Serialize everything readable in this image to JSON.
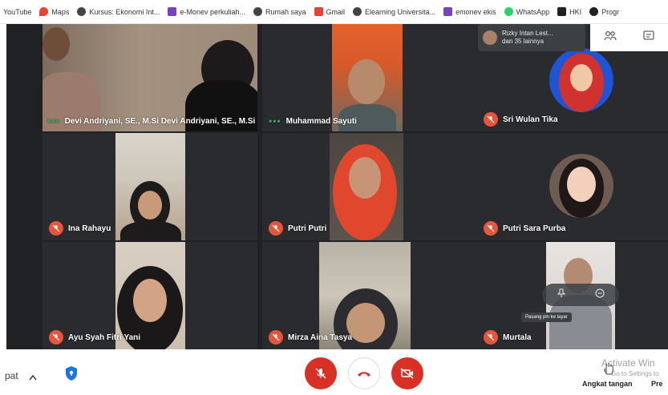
{
  "bookmarks": [
    {
      "label": "YouTube",
      "color": "#ffffff"
    },
    {
      "label": "Maps",
      "color": "#ea4335"
    },
    {
      "label": "Kursus: Ekonomi Int...",
      "color": "#444444"
    },
    {
      "label": "e-Monev perkuliah...",
      "color": "#7b3fbf"
    },
    {
      "label": "Rumah saya",
      "color": "#444444"
    },
    {
      "label": "Gmail",
      "color": "#ea4335"
    },
    {
      "label": "Elearning Universita...",
      "color": "#444444"
    },
    {
      "label": "emonev ekis",
      "color": "#7b3fbf"
    },
    {
      "label": "WhatsApp",
      "color": "#25d366"
    },
    {
      "label": "HKI",
      "color": "#222222"
    },
    {
      "label": "Progr",
      "color": "#222222"
    }
  ],
  "participants": [
    {
      "name": "Devi Andriyani, SE., M.Si Devi Andriyani, SE., M.Si",
      "status": "speaking"
    },
    {
      "name": "Muhammad Sayuti",
      "status": "speaking"
    },
    {
      "name": "Sri Wulan Tika",
      "status": "muted"
    },
    {
      "name": "Ina Rahayu",
      "status": "muted"
    },
    {
      "name": "Putri Putri",
      "status": "muted"
    },
    {
      "name": "Putri Sara Purba",
      "status": "muted"
    },
    {
      "name": "Ayu Syah Fitri Yani",
      "status": "muted"
    },
    {
      "name": "Mirza Aina Tasya",
      "status": "muted"
    },
    {
      "name": "Murtala",
      "status": "muted"
    }
  ],
  "notification": {
    "line1": "Rizky Intan Lest...",
    "line2": "dan 35 lainnya"
  },
  "tooltip": "Pasang pin ke layar",
  "bottom": {
    "left_label": "pat",
    "raise_hand": "Angkat tangan",
    "present": "Pre",
    "watermark_title": "Activate Win",
    "watermark_sub": "Go to Settings to"
  },
  "colors": {
    "stage": "#202124",
    "tile": "#3c4043",
    "muted": "#e8553a",
    "end_call": "#d93025"
  }
}
